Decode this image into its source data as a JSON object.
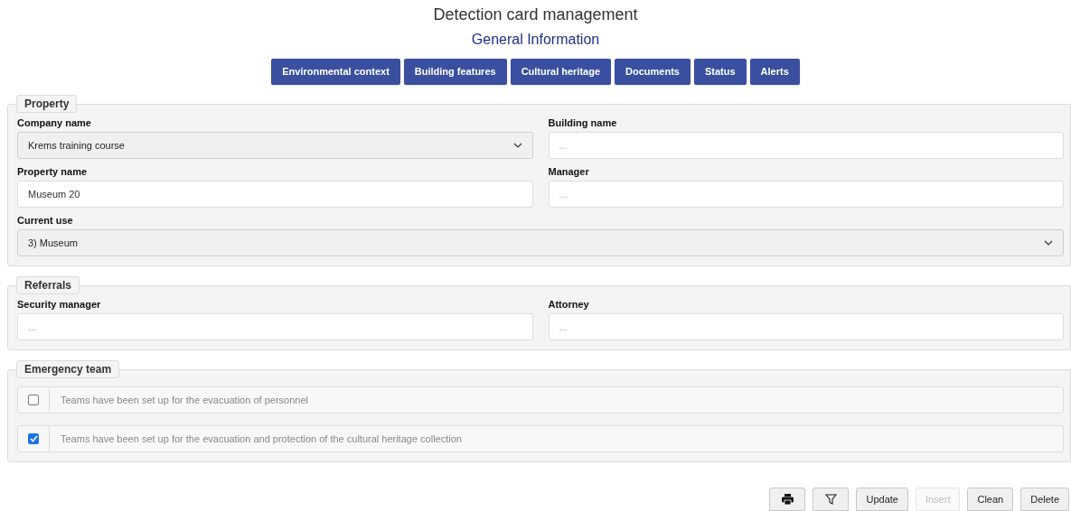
{
  "title": "Detection card management",
  "subtitle": "General Information",
  "nav_buttons": [
    "Environmental context",
    "Building features",
    "Cultural heritage",
    "Documents",
    "Status",
    "Alerts"
  ],
  "sections": [
    {
      "legend": "Property",
      "rows": [
        [
          {
            "label": "Company name",
            "kind": "select",
            "value": "Krems training course"
          },
          {
            "label": "Building name",
            "kind": "input",
            "placeholder": "..."
          }
        ],
        [
          {
            "label": "Property name",
            "kind": "input",
            "value": "Museum 20"
          },
          {
            "label": "Manager",
            "kind": "input",
            "placeholder": "..."
          }
        ],
        [
          {
            "label": "Current use",
            "kind": "select",
            "value": "3) Museum"
          }
        ]
      ]
    },
    {
      "legend": "Referrals",
      "rows": [
        [
          {
            "label": "Security manager",
            "kind": "input",
            "placeholder": "..."
          },
          {
            "label": "Attorney",
            "kind": "input",
            "placeholder": "..."
          }
        ]
      ]
    }
  ],
  "emergency_team": {
    "legend": "Emergency team",
    "checks": [
      {
        "label": "Teams have been set up for the evacuation of personnel",
        "checked": false
      },
      {
        "label": "Teams have been set up for the evacuation and protection of the cultural heritage collection",
        "checked": true
      }
    ]
  },
  "actions": [
    {
      "kind": "print",
      "disabled": false
    },
    {
      "kind": "filter",
      "disabled": false
    },
    {
      "kind": "text",
      "label": "Update",
      "disabled": false
    },
    {
      "kind": "text",
      "label": "Insert",
      "disabled": true
    },
    {
      "kind": "text",
      "label": "Clean",
      "disabled": false
    },
    {
      "kind": "text",
      "label": "Delete",
      "disabled": false
    }
  ]
}
